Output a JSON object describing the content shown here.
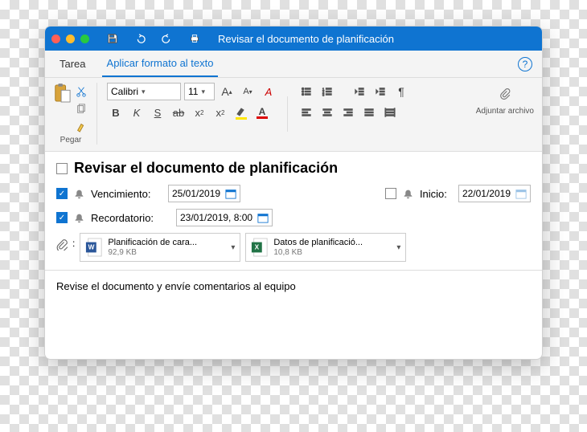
{
  "title": "Revisar el documento de planificación",
  "tabs": {
    "task": "Tarea",
    "format": "Aplicar formato al texto"
  },
  "ribbon": {
    "paste": "Pegar",
    "attach": "Adjuntar archivo",
    "font_name": "Calibri",
    "font_size": "11"
  },
  "task": {
    "title": "Revisar el documento de planificación",
    "due_label": "Vencimiento:",
    "due_date": "25/01/2019",
    "start_label": "Inicio:",
    "start_date": "22/01/2019",
    "reminder_label": "Recordatorio:",
    "reminder_value": "23/01/2019, 8:00"
  },
  "attachments": [
    {
      "name": "Planificación de cara...",
      "size": "92,9 KB"
    },
    {
      "name": "Datos de planificació...",
      "size": "10,8 KB"
    }
  ],
  "notes": "Revise el documento y envíe comentarios al equipo"
}
